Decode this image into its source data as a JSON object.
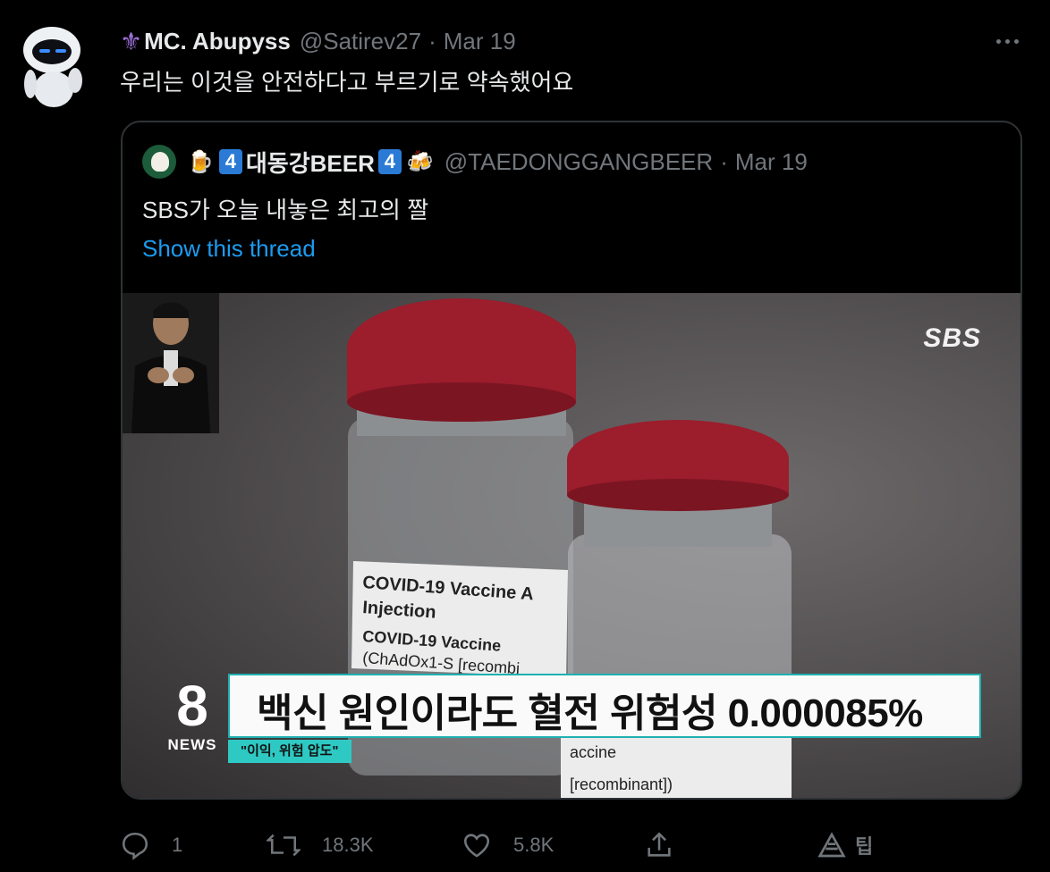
{
  "tweet": {
    "display_name": "MC. Abupyss",
    "handle": "@Satirev27",
    "separator": "·",
    "date": "Mar 19",
    "text": "우리는 이것을 안전하다고 부르기로 약속했어요",
    "name_prefix_icon": "fleur-de-lis-icon"
  },
  "quoted": {
    "display_name": "대동강BEER",
    "badge_number": "4",
    "handle": "@TAEDONGGANGBEER",
    "separator": "·",
    "date": "Mar 19",
    "text": "SBS가 오늘 내놓은 최고의 짤",
    "show_thread": "Show this thread",
    "media": {
      "channel_logo": "SBS",
      "news_logo_number": "8",
      "news_logo_word": "NEWS",
      "headline": "백신 원인이라도 혈전 위험성 0.000085%",
      "tag": "\"이익, 위험 압도\"",
      "label_line1": "COVID-19 Vaccine A",
      "label_line2": "Injection",
      "label_line3": "COVID-19 Vaccine",
      "label_line4": "(ChAdOx1-S [recombi",
      "label2_line1": "accine",
      "label2_line2": "[recombinant])"
    }
  },
  "actions": {
    "reply_count": "1",
    "retweet_count": "18.3K",
    "like_count": "5.8K",
    "tip_label": "팁"
  },
  "colors": {
    "background": "#000000",
    "text": "#e7e9ea",
    "secondary": "#71767b",
    "link": "#1d9bf0",
    "border": "#2f3336"
  }
}
